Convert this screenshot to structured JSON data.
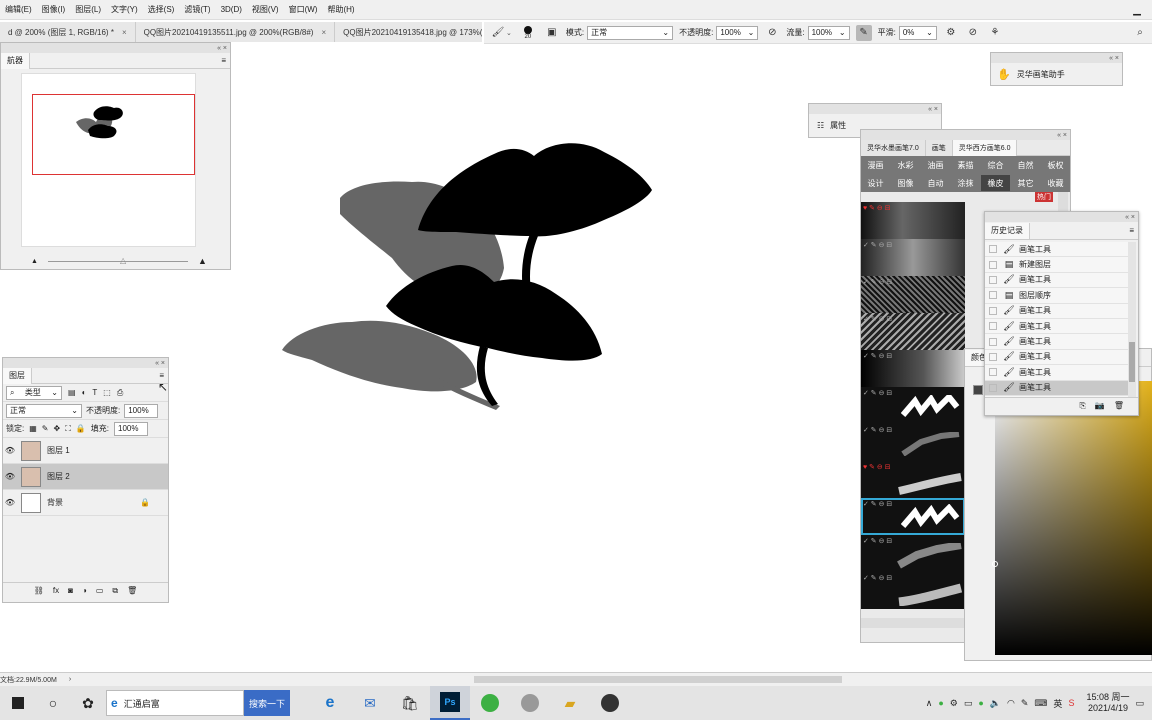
{
  "menu": [
    "编辑(E)",
    "图像(I)",
    "图层(L)",
    "文字(Y)",
    "选择(S)",
    "滤镜(T)",
    "3D(D)",
    "视图(V)",
    "窗口(W)",
    "帮助(H)"
  ],
  "doc_tabs": [
    {
      "label": "d @ 200% (图层 1, RGB/16) *",
      "close": "×"
    },
    {
      "label": "QQ图片20210419135511.jpg @ 200%(RGB/8#)",
      "close": "×"
    },
    {
      "label": "QQ图片20210419135418.jpg @ 173%(R(",
      "close": ""
    }
  ],
  "options": {
    "brush_size": "20",
    "mode_label": "模式:",
    "mode_value": "正常",
    "opacity_label": "不透明度:",
    "opacity_value": "100%",
    "flow_label": "流量:",
    "flow_value": "100%",
    "smooth_label": "平滑:",
    "smooth_value": "0%"
  },
  "navigator": {
    "tab": "航器"
  },
  "layers_panel": {
    "tab": "图层",
    "filter": "类型",
    "blend": "正常",
    "opacity_label": "不透明度:",
    "opacity_value": "100%",
    "lock_label": "锁定:",
    "fill_label": "填充:",
    "fill_value": "100%",
    "layers": [
      {
        "name": "图层 1",
        "selected": false
      },
      {
        "name": "图层 2",
        "selected": true
      },
      {
        "name": "背景",
        "selected": false
      }
    ]
  },
  "plugin_panel": {
    "label": "灵华画笔助手"
  },
  "properties_panel": {
    "label": "属性"
  },
  "brush_panel": {
    "tab1": "灵华水墨画笔7.0",
    "tab2": "画笔",
    "tab3": "灵华西方画笔6.0",
    "row1": [
      "漫画",
      "水彩",
      "油画",
      "素描",
      "综合",
      "自然",
      "板权"
    ],
    "row2": [
      "设计",
      "图像",
      "自动",
      "涂抹",
      "橡皮",
      "其它",
      "收藏"
    ],
    "badge": "热门"
  },
  "history_panel": {
    "tab": "历史记录",
    "items": [
      "画笔工具",
      "新建图层",
      "画笔工具",
      "图层顺序",
      "画笔工具",
      "画笔工具",
      "画笔工具",
      "画笔工具",
      "画笔工具",
      "画笔工具"
    ]
  },
  "color_panel": {
    "tab": "颜色"
  },
  "status": {
    "doc": "文档:22.9M/5.00M"
  },
  "taskbar": {
    "search_text": "汇通启富",
    "search_button": "搜索一下",
    "ime": "英",
    "time": "15:08 周一",
    "date": "2021/4/19"
  },
  "colors": {
    "accent": "#3a6cc6",
    "swatch_red": "#cc3333",
    "ps_blue": "#31a8ff"
  }
}
